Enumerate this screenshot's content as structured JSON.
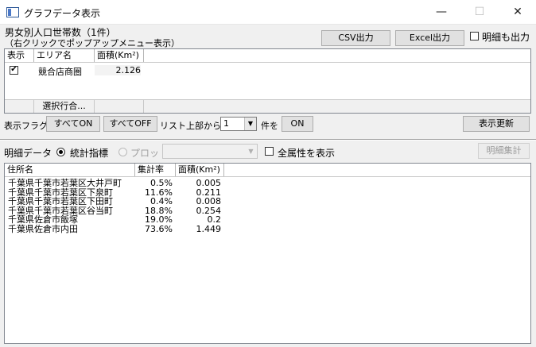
{
  "window": {
    "title": "グラフデータ表示",
    "minimize_glyph": "—",
    "maximize_glyph": "☐",
    "close_glyph": "✕"
  },
  "top": {
    "layer_label": "男女別人口世帯数（1件）",
    "hint_label": "（右クリックでポップアップメニュー表示）",
    "csv_button": "CSV出力",
    "excel_button": "Excel出力",
    "detail_output_label": "明細も出力",
    "detail_output_checked": false
  },
  "area_table": {
    "columns": [
      "表示",
      "エリア名",
      "面積(Km²)"
    ],
    "rows": [
      {
        "checked": true,
        "check_glyph": "✔",
        "name": "競合店商圏",
        "area": "2.126"
      }
    ],
    "footer": "選択行合..."
  },
  "flags": {
    "label": "表示フラグ",
    "all_on": "すべてON",
    "all_off": "すべてOFF",
    "from_top_label": "リスト上部から",
    "count_value": "1",
    "count_suffix": "件を",
    "on_button": "ON",
    "refresh_button": "表示更新"
  },
  "detail": {
    "label": "明細データ",
    "radio_stats": "統計指標",
    "radio_plot": "プロット",
    "all_attrs_label": "全属性を表示",
    "aggregate_button": "明細集計",
    "columns": [
      "住所名",
      "集計率",
      "面積(Km²)"
    ],
    "rows": [
      {
        "address": "千葉県千葉市若葉区大井戸町",
        "rate": "0.5%",
        "area": "0.005"
      },
      {
        "address": "千葉県千葉市若葉区下泉町",
        "rate": "11.6%",
        "area": "0.211"
      },
      {
        "address": "千葉県千葉市若葉区下田町",
        "rate": "0.4%",
        "area": "0.008"
      },
      {
        "address": "千葉県千葉市若葉区谷当町",
        "rate": "18.8%",
        "area": "0.254"
      },
      {
        "address": "千葉県佐倉市飯塚",
        "rate": "19.0%",
        "area": "0.2"
      },
      {
        "address": "千葉県佐倉市内田",
        "rate": "73.6%",
        "area": "1.449"
      }
    ]
  },
  "icons": {
    "dropdown_glyph": "▼",
    "app_icon": "window-icon"
  }
}
